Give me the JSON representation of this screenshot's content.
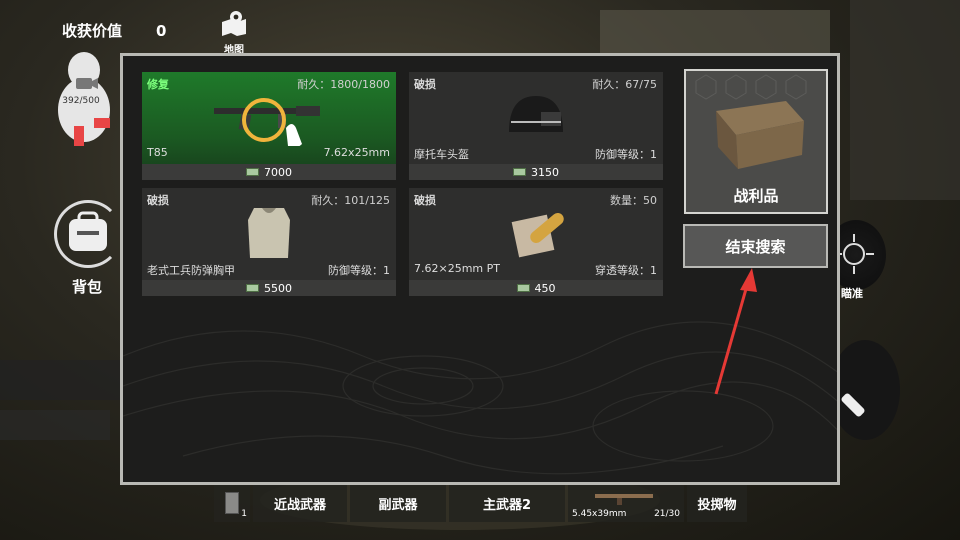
{
  "hud": {
    "loot_value_label": "收获价值",
    "loot_value": "0",
    "map_label": "地图"
  },
  "avatar": {
    "capacity": "392/500"
  },
  "backpack": {
    "label": "背包"
  },
  "aim": {
    "label": "瞄准"
  },
  "bottom_bar": {
    "consumable_count": "1",
    "melee_label": "近战武器",
    "secondary_label": "副武器",
    "primary2_label": "主武器2",
    "primary_ammo_type": "5.45x39mm",
    "primary_ammo_count": "21/30",
    "throwable_label": "投掷物"
  },
  "items": [
    {
      "status": "修复",
      "stat": "耐久：1800/1800",
      "name": "T85",
      "attr": "7.62x25mm",
      "price": "7000",
      "icon": "rifle-icon"
    },
    {
      "status": "破损",
      "stat": "耐久：67/75",
      "name": "摩托车头盔",
      "attr": "防御等级：1",
      "price": "3150",
      "icon": "helmet-icon"
    },
    {
      "status": "破损",
      "stat": "耐久：101/125",
      "name": "老式工兵防弹胸甲",
      "attr": "防御等级：1",
      "price": "5500",
      "icon": "vest-icon"
    },
    {
      "status": "破损",
      "stat": "数量：50",
      "name": "7.62×25mm PT",
      "attr": "穿透等级：1",
      "price": "450",
      "icon": "ammo-icon"
    }
  ],
  "loot": {
    "title": "战利品"
  },
  "end_search": {
    "label": "结束搜索"
  },
  "colors": {
    "repaired": "#1f7a2a",
    "panel_border": "#b9b9b4",
    "arrow": "#e53935"
  }
}
